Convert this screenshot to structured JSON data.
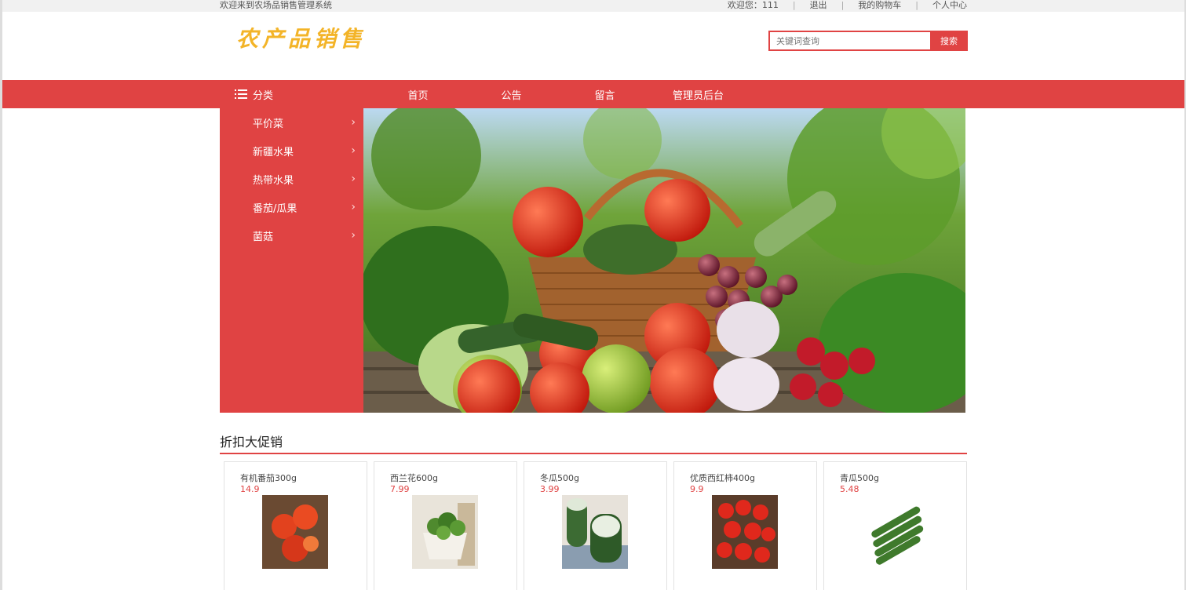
{
  "topbar": {
    "welcome": "欢迎来到农场品销售管理系统",
    "greeting": "欢迎您：111",
    "logout": "退出",
    "cart": "我的购物车",
    "profile": "个人中心",
    "separator": "|"
  },
  "header": {
    "logo": "农产品销售",
    "search_placeholder": "关键词查询",
    "search_button": "搜索"
  },
  "nav": {
    "category_label": "分类",
    "items": [
      "首页",
      "公告",
      "留言",
      "管理员后台"
    ]
  },
  "sidebar": {
    "items": [
      "平价菜",
      "新疆水果",
      "热带水果",
      "番茄/瓜果",
      "菌菇"
    ]
  },
  "promo": {
    "title": "折扣大促销",
    "products": [
      {
        "name": "有机番茄300g",
        "price": "14.9"
      },
      {
        "name": "西兰花600g",
        "price": "7.99"
      },
      {
        "name": "冬瓜500g",
        "price": "3.99"
      },
      {
        "name": "优质西红柿400g",
        "price": "9.9"
      },
      {
        "name": "青瓜500g",
        "price": "5.48"
      }
    ]
  },
  "colors": {
    "accent": "#e04343",
    "logo": "#f3b428"
  }
}
